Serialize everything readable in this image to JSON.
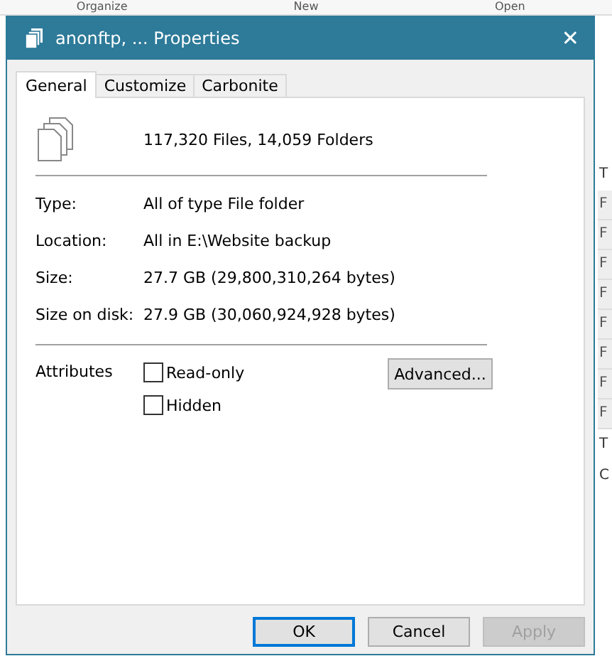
{
  "background": {
    "toolbar": [
      "Organize",
      "New",
      "Open"
    ],
    "side_letters": [
      {
        "text": "T",
        "kind": "label"
      },
      {
        "text": "F",
        "kind": "cell"
      },
      {
        "text": "F",
        "kind": "cell"
      },
      {
        "text": "F",
        "kind": "cell"
      },
      {
        "text": "F",
        "kind": "cell"
      },
      {
        "text": "F",
        "kind": "cell"
      },
      {
        "text": "F",
        "kind": "cell"
      },
      {
        "text": "F",
        "kind": "cell"
      },
      {
        "text": "F",
        "kind": "cell"
      },
      {
        "text": "T",
        "kind": "label"
      },
      {
        "text": "C",
        "kind": "label"
      }
    ]
  },
  "window": {
    "title": "anonftp, ... Properties",
    "close": "✕"
  },
  "tabs": [
    {
      "label": "General",
      "selected": true
    },
    {
      "label": "Customize",
      "selected": false
    },
    {
      "label": "Carbonite",
      "selected": false
    }
  ],
  "summary": "117,320 Files, 14,059 Folders",
  "properties": [
    {
      "label": "Type:",
      "value": "All of type File folder"
    },
    {
      "label": "Location:",
      "value": "All in E:\\Website backup"
    },
    {
      "label": "Size:",
      "value": "27.7 GB (29,800,310,264 bytes)"
    },
    {
      "label": "Size on disk:",
      "value": "27.9 GB (30,060,924,928 bytes)"
    }
  ],
  "attributes": {
    "label": "Attributes",
    "options": [
      {
        "label": "Read-only",
        "checked": false
      },
      {
        "label": "Hidden",
        "checked": false
      }
    ],
    "advanced": "Advanced..."
  },
  "buttons": [
    {
      "label": "OK",
      "kind": "default",
      "disabled": false
    },
    {
      "label": "Cancel",
      "kind": "normal",
      "disabled": false
    },
    {
      "label": "Apply",
      "kind": "normal",
      "disabled": true
    }
  ]
}
